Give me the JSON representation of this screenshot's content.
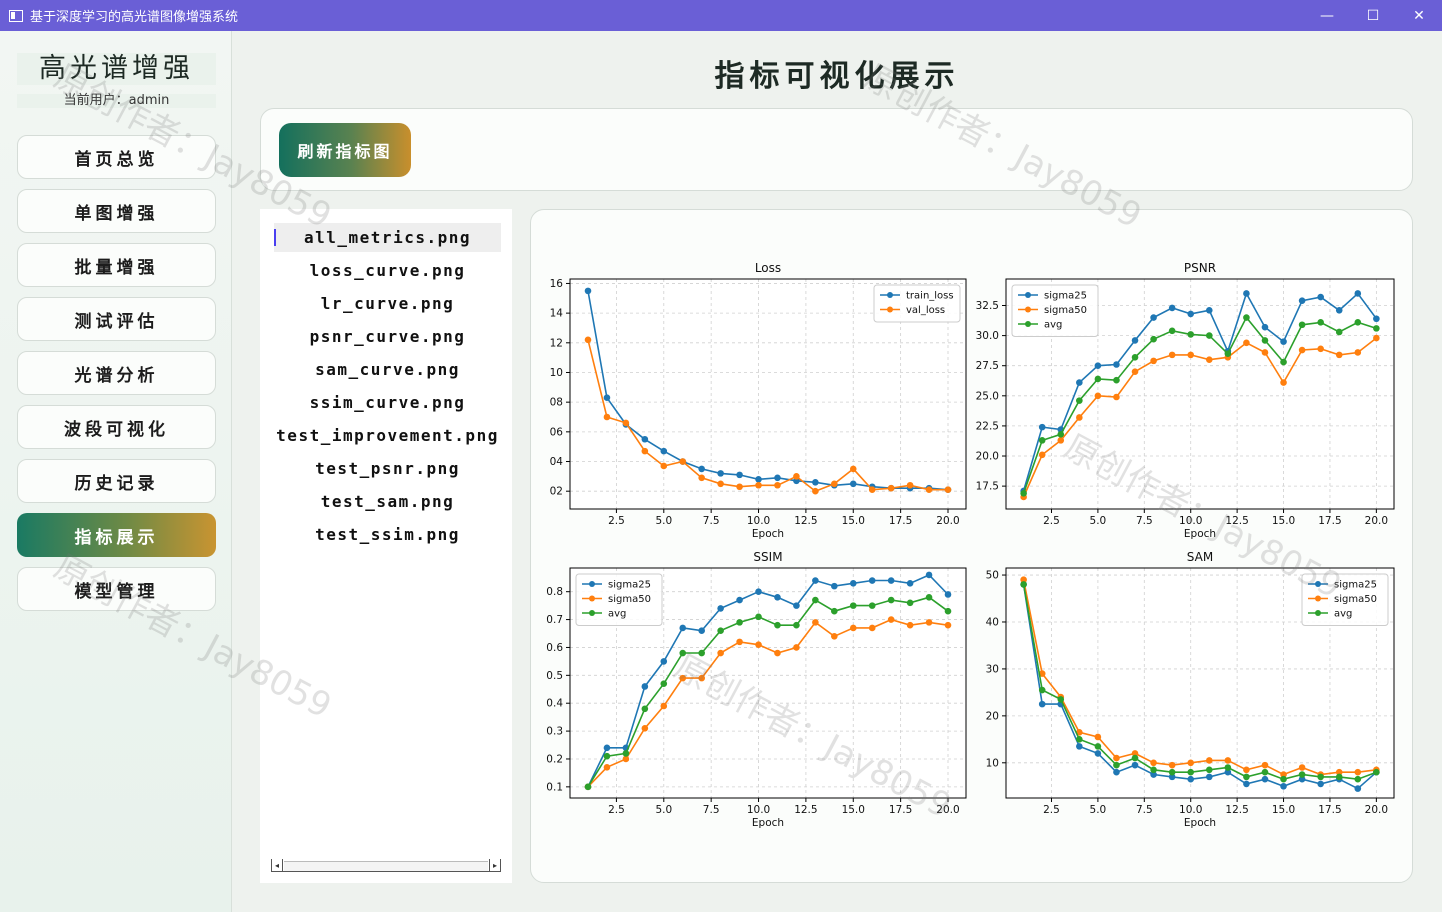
{
  "window": {
    "title": "基于深度学习的高光谱图像增强系统",
    "minimize": "—",
    "maximize": "☐",
    "close": "✕"
  },
  "sidebar": {
    "brand": "高光谱增强",
    "user": "当前用户：admin",
    "items": [
      {
        "label": "首页总览"
      },
      {
        "label": "单图增强"
      },
      {
        "label": "批量增强"
      },
      {
        "label": "测试评估"
      },
      {
        "label": "光谱分析"
      },
      {
        "label": "波段可视化"
      },
      {
        "label": "历史记录"
      },
      {
        "label": "指标展示",
        "active": true
      },
      {
        "label": "模型管理"
      }
    ]
  },
  "main": {
    "title": "指标可视化展示",
    "refresh_label": "刷新指标图",
    "files": [
      "all_metrics.png",
      "loss_curve.png",
      "lr_curve.png",
      "psnr_curve.png",
      "sam_curve.png",
      "ssim_curve.png",
      "test_improvement.png",
      "test_psnr.png",
      "test_sam.png",
      "test_ssim.png"
    ],
    "selected_file": "all_metrics.png"
  },
  "watermark": "原创作者：Jay8059",
  "colors": {
    "blue": "#1f77b4",
    "orange": "#ff7f0e",
    "green": "#2ca02c",
    "accent_start": "#1a7a63",
    "accent_end": "#c99431"
  },
  "chart_data": [
    {
      "type": "line",
      "title": "Loss",
      "xlabel": "Epoch",
      "ylabel": "",
      "xlim": [
        0.05,
        20.95
      ],
      "ylim": [
        0.008,
        0.163
      ],
      "xticks": [
        2.5,
        5.0,
        7.5,
        10.0,
        12.5,
        15.0,
        17.5,
        20.0
      ],
      "xtick_labels": [
        "2.5",
        "5.0",
        "7.5",
        "10.0",
        "12.5",
        "15.0",
        "17.5",
        "20.0"
      ],
      "yticks": [
        0.02,
        0.04,
        0.06,
        0.08,
        0.1,
        0.12,
        0.14,
        0.16
      ],
      "ytick_labels": [
        "02",
        "04",
        "06",
        "08",
        "10",
        "12",
        "14",
        "16"
      ],
      "grid": true,
      "legend": "top-right",
      "x": [
        1,
        2,
        3,
        4,
        5,
        6,
        7,
        8,
        9,
        10,
        11,
        12,
        13,
        14,
        15,
        16,
        17,
        18,
        19,
        20
      ],
      "series": [
        {
          "name": "train_loss",
          "color": "#1f77b4",
          "values": [
            0.155,
            0.083,
            0.065,
            0.055,
            0.047,
            0.04,
            0.035,
            0.032,
            0.031,
            0.028,
            0.029,
            0.027,
            0.026,
            0.024,
            0.025,
            0.023,
            0.022,
            0.022,
            0.022,
            0.021
          ]
        },
        {
          "name": "val_loss",
          "color": "#ff7f0e",
          "values": [
            0.122,
            0.07,
            0.066,
            0.047,
            0.037,
            0.04,
            0.029,
            0.025,
            0.023,
            0.024,
            0.024,
            0.03,
            0.02,
            0.025,
            0.035,
            0.021,
            0.022,
            0.024,
            0.021,
            0.021
          ]
        }
      ]
    },
    {
      "type": "line",
      "title": "PSNR",
      "xlabel": "Epoch",
      "ylabel": "",
      "xlim": [
        0.05,
        20.95
      ],
      "ylim": [
        15.6,
        34.7
      ],
      "xticks": [
        2.5,
        5.0,
        7.5,
        10.0,
        12.5,
        15.0,
        17.5,
        20.0
      ],
      "xtick_labels": [
        "2.5",
        "5.0",
        "7.5",
        "10.0",
        "12.5",
        "15.0",
        "17.5",
        "20.0"
      ],
      "yticks": [
        17.5,
        20.0,
        22.5,
        25.0,
        27.5,
        30.0,
        32.5
      ],
      "ytick_labels": [
        "17.5",
        "20.0",
        "22.5",
        "25.0",
        "27.5",
        "30.0",
        "32.5"
      ],
      "grid": true,
      "legend": "top-left",
      "x": [
        1,
        2,
        3,
        4,
        5,
        6,
        7,
        8,
        9,
        10,
        11,
        12,
        13,
        14,
        15,
        16,
        17,
        18,
        19,
        20
      ],
      "series": [
        {
          "name": "sigma25",
          "color": "#1f77b4",
          "values": [
            17.1,
            22.4,
            22.2,
            26.1,
            27.5,
            27.6,
            29.6,
            31.5,
            32.3,
            31.8,
            32.1,
            28.7,
            33.5,
            30.7,
            29.5,
            32.9,
            33.2,
            32.1,
            33.5,
            31.4
          ]
        },
        {
          "name": "sigma50",
          "color": "#ff7f0e",
          "values": [
            16.6,
            20.1,
            21.3,
            23.2,
            25.0,
            24.9,
            27.0,
            27.9,
            28.4,
            28.4,
            28.0,
            28.2,
            29.4,
            28.6,
            26.1,
            28.8,
            28.9,
            28.4,
            28.6,
            29.8
          ]
        },
        {
          "name": "avg",
          "color": "#2ca02c",
          "values": [
            16.9,
            21.3,
            21.8,
            24.6,
            26.4,
            26.3,
            28.2,
            29.7,
            30.4,
            30.1,
            30.0,
            28.5,
            31.5,
            29.6,
            27.8,
            30.9,
            31.1,
            30.3,
            31.1,
            30.6
          ]
        }
      ]
    },
    {
      "type": "line",
      "title": "SSIM",
      "xlabel": "Epoch",
      "ylabel": "",
      "xlim": [
        0.05,
        20.95
      ],
      "ylim": [
        0.06,
        0.885
      ],
      "xticks": [
        2.5,
        5.0,
        7.5,
        10.0,
        12.5,
        15.0,
        17.5,
        20.0
      ],
      "xtick_labels": [
        "2.5",
        "5.0",
        "7.5",
        "10.0",
        "12.5",
        "15.0",
        "17.5",
        "20.0"
      ],
      "yticks": [
        0.1,
        0.2,
        0.3,
        0.4,
        0.5,
        0.6,
        0.7,
        0.8
      ],
      "ytick_labels": [
        "0.1",
        "0.2",
        "0.3",
        "0.4",
        "0.5",
        "0.6",
        "0.7",
        "0.8"
      ],
      "grid": true,
      "legend": "top-left",
      "x": [
        1,
        2,
        3,
        4,
        5,
        6,
        7,
        8,
        9,
        10,
        11,
        12,
        13,
        14,
        15,
        16,
        17,
        18,
        19,
        20
      ],
      "series": [
        {
          "name": "sigma25",
          "color": "#1f77b4",
          "values": [
            0.1,
            0.24,
            0.24,
            0.46,
            0.55,
            0.67,
            0.66,
            0.74,
            0.77,
            0.8,
            0.78,
            0.75,
            0.84,
            0.82,
            0.83,
            0.84,
            0.84,
            0.83,
            0.86,
            0.79
          ]
        },
        {
          "name": "sigma50",
          "color": "#ff7f0e",
          "values": [
            0.1,
            0.17,
            0.2,
            0.31,
            0.39,
            0.49,
            0.49,
            0.58,
            0.62,
            0.61,
            0.58,
            0.6,
            0.69,
            0.64,
            0.67,
            0.67,
            0.7,
            0.68,
            0.69,
            0.68
          ]
        },
        {
          "name": "avg",
          "color": "#2ca02c",
          "values": [
            0.1,
            0.21,
            0.22,
            0.38,
            0.47,
            0.58,
            0.58,
            0.66,
            0.69,
            0.71,
            0.68,
            0.68,
            0.77,
            0.73,
            0.75,
            0.75,
            0.77,
            0.76,
            0.78,
            0.73
          ]
        }
      ]
    },
    {
      "type": "line",
      "title": "SAM",
      "xlabel": "Epoch",
      "ylabel": "",
      "xlim": [
        0.05,
        20.95
      ],
      "ylim": [
        2.5,
        51.5
      ],
      "xticks": [
        2.5,
        5.0,
        7.5,
        10.0,
        12.5,
        15.0,
        17.5,
        20.0
      ],
      "xtick_labels": [
        "2.5",
        "5.0",
        "7.5",
        "10.0",
        "12.5",
        "15.0",
        "17.5",
        "20.0"
      ],
      "yticks": [
        10,
        20,
        30,
        40,
        50
      ],
      "ytick_labels": [
        "10",
        "20",
        "30",
        "40",
        "50"
      ],
      "grid": true,
      "legend": "top-right",
      "x": [
        1,
        2,
        3,
        4,
        5,
        6,
        7,
        8,
        9,
        10,
        11,
        12,
        13,
        14,
        15,
        16,
        17,
        18,
        19,
        20
      ],
      "series": [
        {
          "name": "sigma25",
          "color": "#1f77b4",
          "values": [
            48.0,
            22.5,
            22.5,
            13.5,
            12.0,
            8.0,
            9.5,
            7.5,
            7.0,
            6.5,
            7.0,
            8.0,
            5.5,
            6.5,
            5.0,
            6.5,
            5.5,
            6.5,
            4.5,
            8.0
          ]
        },
        {
          "name": "sigma50",
          "color": "#ff7f0e",
          "values": [
            49.0,
            29.0,
            24.0,
            16.5,
            15.5,
            11.0,
            12.0,
            10.0,
            9.5,
            10.0,
            10.5,
            10.5,
            8.5,
            9.5,
            7.5,
            9.0,
            7.5,
            8.0,
            8.0,
            8.5
          ]
        },
        {
          "name": "avg",
          "color": "#2ca02c",
          "values": [
            48.0,
            25.5,
            23.5,
            15.0,
            13.5,
            9.5,
            11.0,
            8.5,
            8.0,
            8.0,
            8.5,
            9.0,
            7.0,
            8.0,
            6.5,
            7.5,
            7.0,
            7.0,
            6.5,
            8.0
          ]
        }
      ]
    }
  ]
}
